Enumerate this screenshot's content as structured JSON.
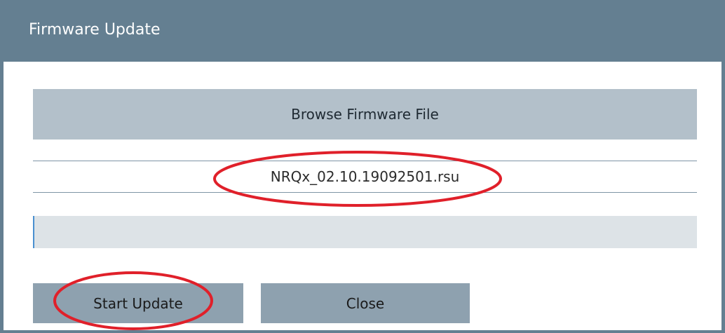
{
  "dialog": {
    "title": "Firmware Update"
  },
  "browse": {
    "label": "Browse Firmware File"
  },
  "file": {
    "name": "NRQx_02.10.19092501.rsu"
  },
  "progress": {
    "percent": 0
  },
  "buttons": {
    "start_update": "Start Update",
    "close": "Close"
  },
  "colors": {
    "title_bar": "#647f91",
    "browse_button": "#b3c0ca",
    "action_button": "#8ea1af",
    "progress_track": "#dde3e7",
    "annotation": "#e0202a"
  }
}
